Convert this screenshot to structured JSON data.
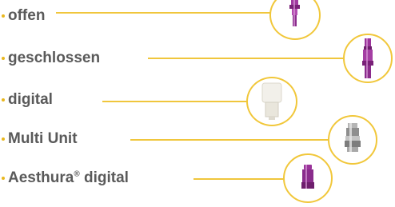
{
  "items": [
    {
      "label": "offen",
      "part": "open-abutment-purple"
    },
    {
      "label": "geschlossen",
      "part": "closed-abutment-purple"
    },
    {
      "label": "digital",
      "part": "digital-scanbody-white"
    },
    {
      "label": "Multi Unit",
      "part": "multi-unit-abutment-silver"
    },
    {
      "label": "Aesthura",
      "label_sup": "®",
      "label_rest": " digital",
      "part": "aesthura-digital-purple"
    }
  ],
  "colors": {
    "accent": "#f0c63c",
    "bullet": "#e9b71e",
    "text": "#5a5a5a",
    "purple": "#8a2c8c",
    "silver": "#9a9a9a",
    "white_part": "#f2f0ea"
  }
}
